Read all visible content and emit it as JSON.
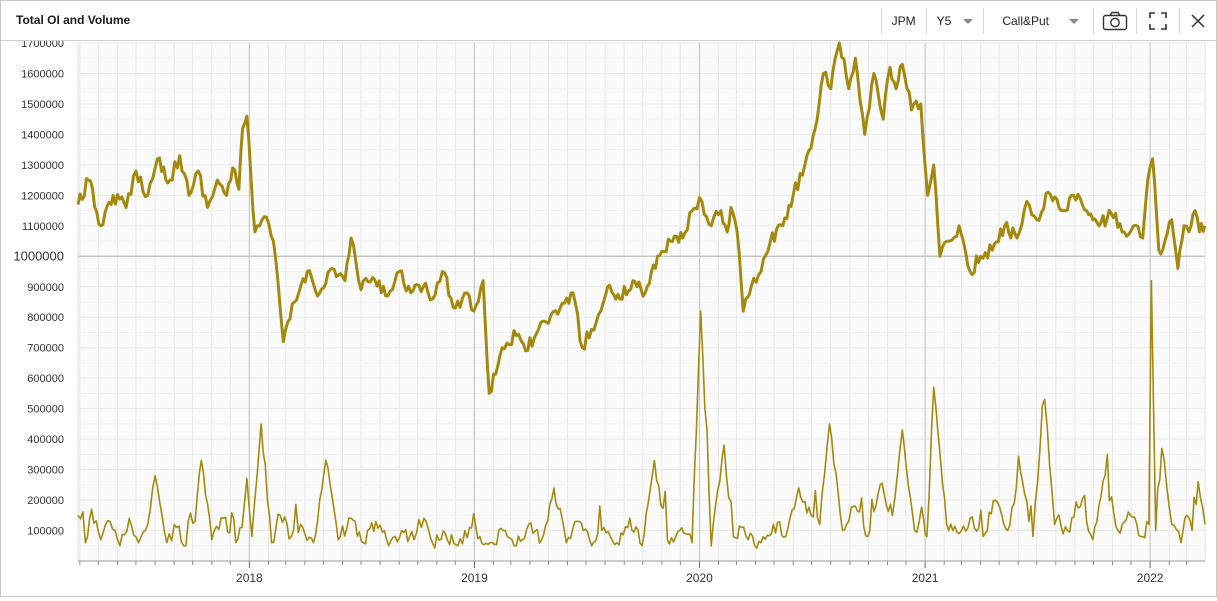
{
  "window": {
    "title": "Total OI and Volume"
  },
  "toolbar": {
    "symbol": "JPM",
    "period": "Y5",
    "option_type": "Call&Put",
    "icons": [
      "camera-icon",
      "fullscreen-icon",
      "close-icon"
    ]
  },
  "colors": {
    "series": "#a38a0f",
    "grid": "#e9e9e9",
    "axis_text": "#333333",
    "plot_bg": "#fbfbfb"
  },
  "chart_data": {
    "type": "line",
    "ylim": [
      0,
      1700000
    ],
    "yticks": [
      "100000",
      "200000",
      "300000",
      "400000",
      "500000",
      "600000",
      "700000",
      "800000",
      "900000",
      "1000000",
      "1100000",
      "1200000",
      "1300000",
      "1400000",
      "1500000",
      "1600000",
      "1700000"
    ],
    "highlighted_ytick": "1000000",
    "xlim": [
      "2017-03-29",
      "2022-03-31"
    ],
    "xticks": [
      {
        "label": "2018",
        "date": "2018-01-01"
      },
      {
        "label": "2019",
        "date": "2019-01-01"
      },
      {
        "label": "2020",
        "date": "2020-01-01"
      },
      {
        "label": "2021",
        "date": "2021-01-01"
      },
      {
        "label": "2022",
        "date": "2022-01-01"
      }
    ],
    "grid": true,
    "series": [
      {
        "key": "oi",
        "x": [
          "2017-03-29",
          "2017-04-15",
          "2017-05-05",
          "2017-05-25",
          "2017-06-15",
          "2017-07-01",
          "2017-07-20",
          "2017-08-05",
          "2017-08-25",
          "2017-09-10",
          "2017-09-25",
          "2017-10-10",
          "2017-10-25",
          "2017-11-10",
          "2017-11-25",
          "2017-12-05",
          "2017-12-15",
          "2017-12-21",
          "2017-12-28",
          "2018-01-10",
          "2018-01-25",
          "2018-02-09",
          "2018-02-25",
          "2018-03-15",
          "2018-04-05",
          "2018-04-25",
          "2018-05-15",
          "2018-06-05",
          "2018-06-15",
          "2018-07-01",
          "2018-07-20",
          "2018-08-10",
          "2018-09-01",
          "2018-09-20",
          "2018-10-10",
          "2018-10-25",
          "2018-11-10",
          "2018-12-01",
          "2018-12-20",
          "2018-12-31",
          "2019-01-15",
          "2019-01-25",
          "2019-02-15",
          "2019-03-10",
          "2019-03-25",
          "2019-04-15",
          "2019-05-01",
          "2019-05-20",
          "2019-06-10",
          "2019-06-25",
          "2019-07-10",
          "2019-07-25",
          "2019-08-05",
          "2019-08-25",
          "2019-09-15",
          "2019-10-05",
          "2019-10-25",
          "2019-11-15",
          "2019-12-05",
          "2019-12-20",
          "2020-01-05",
          "2020-01-20",
          "2020-02-05",
          "2020-02-15",
          "2020-02-21",
          "2020-03-02",
          "2020-03-12",
          "2020-03-16",
          "2020-03-25",
          "2020-04-10",
          "2020-04-25",
          "2020-05-15",
          "2020-06-01",
          "2020-06-20",
          "2020-07-10",
          "2020-07-20",
          "2020-08-01",
          "2020-08-15",
          "2020-08-30",
          "2020-09-10",
          "2020-09-25",
          "2020-10-10",
          "2020-10-25",
          "2020-11-05",
          "2020-11-15",
          "2020-11-25",
          "2020-12-10",
          "2020-12-25",
          "2021-01-05",
          "2021-01-15",
          "2021-01-25",
          "2021-02-10",
          "2021-02-25",
          "2021-03-15",
          "2021-04-01",
          "2021-04-20",
          "2021-05-10",
          "2021-05-30",
          "2021-06-15",
          "2021-07-01",
          "2021-07-20",
          "2021-08-10",
          "2021-08-30",
          "2021-09-20",
          "2021-10-10",
          "2021-10-30",
          "2021-11-20",
          "2021-12-05",
          "2021-12-20",
          "2021-12-28",
          "2022-01-05",
          "2022-01-15",
          "2022-01-25",
          "2022-02-05",
          "2022-02-15",
          "2022-02-25",
          "2022-03-05",
          "2022-03-15",
          "2022-03-22",
          "2022-03-31"
        ],
        "values": [
          1170000,
          1250000,
          1100000,
          1200000,
          1160000,
          1280000,
          1200000,
          1320000,
          1250000,
          1330000,
          1200000,
          1280000,
          1160000,
          1250000,
          1200000,
          1290000,
          1220000,
          1420000,
          1460000,
          1080000,
          1130000,
          1050000,
          720000,
          850000,
          950000,
          880000,
          960000,
          920000,
          1060000,
          890000,
          930000,
          870000,
          950000,
          880000,
          900000,
          860000,
          950000,
          830000,
          880000,
          820000,
          920000,
          550000,
          700000,
          740000,
          690000,
          760000,
          780000,
          830000,
          880000,
          700000,
          760000,
          820000,
          900000,
          860000,
          920000,
          880000,
          1000000,
          1050000,
          1060000,
          1150000,
          1180000,
          1100000,
          1150000,
          1080000,
          1160000,
          1080000,
          820000,
          860000,
          900000,
          950000,
          1050000,
          1100000,
          1200000,
          1300000,
          1450000,
          1600000,
          1550000,
          1700000,
          1550000,
          1650000,
          1400000,
          1600000,
          1450000,
          1620000,
          1550000,
          1630000,
          1480000,
          1500000,
          1200000,
          1300000,
          1000000,
          1050000,
          1100000,
          950000,
          1000000,
          1020000,
          1100000,
          1060000,
          1180000,
          1120000,
          1210000,
          1150000,
          1200000,
          1150000,
          1100000,
          1140000,
          1080000,
          1100000,
          1060000,
          1250000,
          1320000,
          1020000,
          1050000,
          1120000,
          960000,
          1100000,
          1080000,
          1150000,
          1080000,
          1100000
        ]
      },
      {
        "key": "volume",
        "x": [
          "2017-03-29",
          "2017-04-10",
          "2017-04-20",
          "2017-05-05",
          "2017-05-20",
          "2017-06-05",
          "2017-06-20",
          "2017-07-05",
          "2017-07-20",
          "2017-08-01",
          "2017-08-20",
          "2017-09-05",
          "2017-09-20",
          "2017-10-05",
          "2017-10-15",
          "2017-11-01",
          "2017-11-20",
          "2017-12-10",
          "2017-12-20",
          "2017-12-28",
          "2018-01-05",
          "2018-01-20",
          "2018-02-06",
          "2018-02-20",
          "2018-03-10",
          "2018-03-25",
          "2018-04-15",
          "2018-05-05",
          "2018-05-25",
          "2018-06-15",
          "2018-07-05",
          "2018-07-25",
          "2018-08-15",
          "2018-09-05",
          "2018-09-25",
          "2018-10-11",
          "2018-10-25",
          "2018-11-15",
          "2018-12-05",
          "2018-12-24",
          "2019-01-10",
          "2019-01-30",
          "2019-02-20",
          "2019-03-10",
          "2019-03-30",
          "2019-04-20",
          "2019-05-10",
          "2019-05-30",
          "2019-06-20",
          "2019-07-10",
          "2019-07-30",
          "2019-08-20",
          "2019-09-10",
          "2019-09-30",
          "2019-10-20",
          "2019-11-10",
          "2019-11-30",
          "2019-12-20",
          "2020-01-03",
          "2020-01-20",
          "2020-02-10",
          "2020-02-25",
          "2020-03-09",
          "2020-03-20",
          "2020-04-10",
          "2020-04-30",
          "2020-05-20",
          "2020-06-10",
          "2020-06-30",
          "2020-07-14",
          "2020-07-30",
          "2020-08-20",
          "2020-09-10",
          "2020-09-30",
          "2020-10-20",
          "2020-11-09",
          "2020-11-25",
          "2020-12-15",
          "2020-12-30",
          "2021-01-04",
          "2021-01-15",
          "2021-02-05",
          "2021-02-25",
          "2021-03-15",
          "2021-04-05",
          "2021-04-25",
          "2021-05-15",
          "2021-06-05",
          "2021-06-25",
          "2021-07-14",
          "2021-07-30",
          "2021-08-20",
          "2021-09-10",
          "2021-09-30",
          "2021-10-20",
          "2021-11-10",
          "2021-11-30",
          "2021-12-20",
          "2021-12-30",
          "2022-01-03",
          "2022-01-10",
          "2022-01-20",
          "2022-02-05",
          "2022-02-20",
          "2022-03-01",
          "2022-03-10",
          "2022-03-20",
          "2022-03-31"
        ],
        "values": [
          150000,
          60000,
          170000,
          70000,
          130000,
          50000,
          140000,
          60000,
          120000,
          280000,
          60000,
          110000,
          50000,
          130000,
          330000,
          70000,
          140000,
          60000,
          110000,
          270000,
          80000,
          450000,
          60000,
          150000,
          80000,
          120000,
          60000,
          330000,
          70000,
          140000,
          60000,
          130000,
          50000,
          100000,
          70000,
          140000,
          60000,
          90000,
          50000,
          110000,
          80000,
          60000,
          100000,
          50000,
          120000,
          70000,
          240000,
          60000,
          130000,
          50000,
          110000,
          60000,
          140000,
          50000,
          330000,
          70000,
          100000,
          60000,
          820000,
          50000,
          380000,
          80000,
          110000,
          70000,
          60000,
          120000,
          80000,
          240000,
          150000,
          120000,
          450000,
          100000,
          180000,
          80000,
          250000,
          150000,
          430000,
          100000,
          130000,
          80000,
          570000,
          120000,
          90000,
          140000,
          80000,
          200000,
          100000,
          290000,
          80000,
          530000,
          120000,
          100000,
          180000,
          70000,
          280000,
          100000,
          150000,
          80000,
          120000,
          920000,
          100000,
          370000,
          120000,
          60000,
          150000,
          100000,
          260000,
          120000
        ]
      }
    ]
  }
}
